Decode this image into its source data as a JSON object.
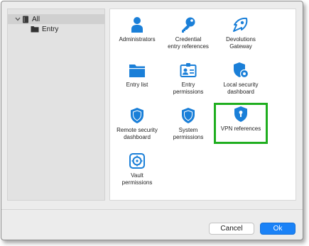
{
  "tree": {
    "root_label": "All",
    "child_label": "Entry"
  },
  "tiles": [
    {
      "label": "Administrators",
      "icon": "user-icon"
    },
    {
      "label": "Credential\nentry references",
      "icon": "key-icon"
    },
    {
      "label": "Devolutions\nGateway",
      "icon": "gateway-icon"
    },
    {
      "label": "Entry list",
      "icon": "folder-icon"
    },
    {
      "label": "Entry\npermissions",
      "icon": "id-card-icon"
    },
    {
      "label": "Local security\ndashboard",
      "icon": "shield-gear-icon"
    },
    {
      "label": "Remote security\ndashboard",
      "icon": "shield-icon"
    },
    {
      "label": "System\npermissions",
      "icon": "shield-icon"
    },
    {
      "label": "VPN references",
      "icon": "shield-lock-icon"
    },
    {
      "label": "Vault\npermissions",
      "icon": "vault-icon"
    }
  ],
  "footer": {
    "cancel_label": "Cancel",
    "ok_label": "Ok"
  },
  "colors": {
    "accent": "#1a82f7",
    "icon": "#1a7fd8",
    "selection": "#1fae1f"
  }
}
